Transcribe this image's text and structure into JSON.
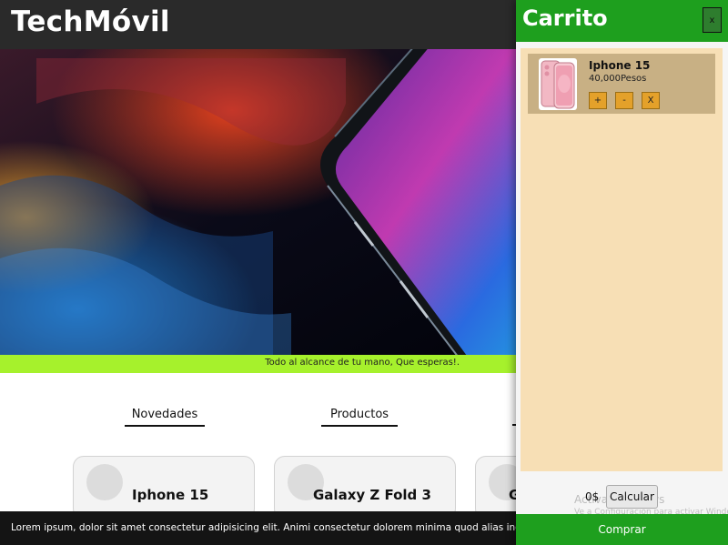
{
  "header": {
    "brand": "TechMóvil"
  },
  "hero": {
    "social_icons": [
      "facebook-icon",
      "twitter-icon",
      "instagram-icon",
      "telegram-icon"
    ],
    "tagline": "Todo al alcance de tu mano, Que esperas!."
  },
  "sections": {
    "tabs": [
      "Novedades",
      "Productos"
    ]
  },
  "products": [
    {
      "name": "Iphone 15"
    },
    {
      "name": "Galaxy Z Fold 3"
    },
    {
      "name": "G"
    }
  ],
  "footer": {
    "text": "Lorem ipsum, dolor sit amet consectetur adipisicing elit. Animi consectetur dolorem minima quod alias incidunt iure"
  },
  "cart": {
    "title": "Carrito",
    "close_label": "x",
    "items": [
      {
        "name": "Iphone 15",
        "price": "40,000Pesos",
        "buttons": [
          "+",
          "-",
          "X"
        ]
      }
    ],
    "total": "0$",
    "calculate_label": "Calcular",
    "buy_label": "Comprar"
  },
  "watermark": {
    "line1": "Activar Windows",
    "line2": "Ve a Configuración para activar Windows."
  },
  "colors": {
    "header": "#2a2a2a",
    "accent_green": "#1e9f1e",
    "tagline_bar": "#a6f12c",
    "cart_bg": "#f7dfb5",
    "item_bg": "#c8b084",
    "qty_button": "#e4a12a"
  }
}
